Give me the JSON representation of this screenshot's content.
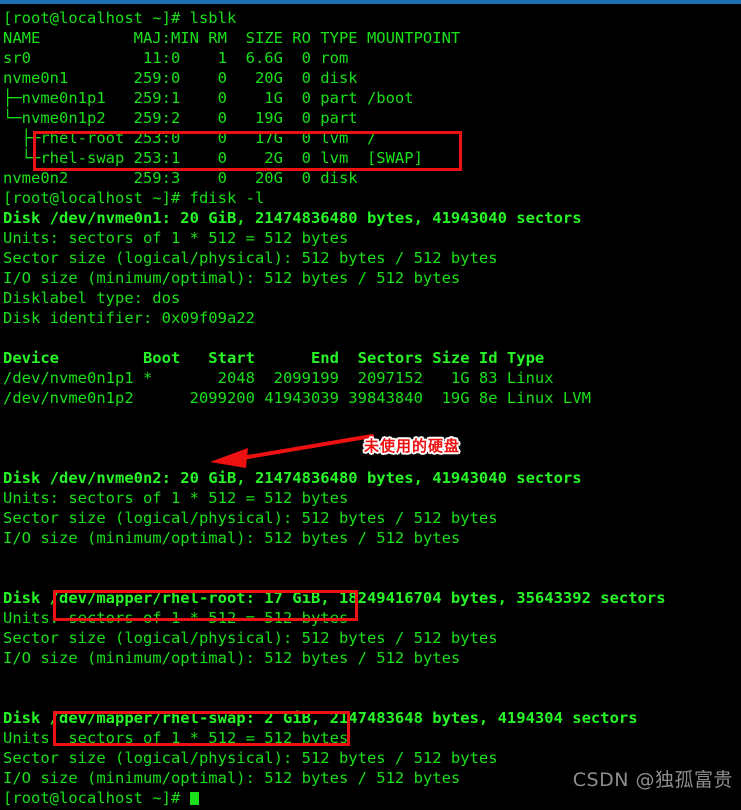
{
  "terminal": {
    "prompt": "[root@localhost ~]#",
    "lines": [
      {
        "text": "[root@localhost ~]# lsblk",
        "bold": false
      },
      {
        "text": "NAME          MAJ:MIN RM  SIZE RO TYPE MOUNTPOINT",
        "bold": false
      },
      {
        "text": "sr0            11:0    1  6.6G  0 rom",
        "bold": false
      },
      {
        "text": "nvme0n1       259:0    0   20G  0 disk",
        "bold": false
      },
      {
        "text": "├─nvme0n1p1   259:1    0    1G  0 part /boot",
        "bold": false
      },
      {
        "text": "└─nvme0n1p2   259:2    0   19G  0 part",
        "bold": false
      },
      {
        "text": "  ├─rhel-root 253:0    0   17G  0 lvm  /",
        "bold": false
      },
      {
        "text": "  └─rhel-swap 253:1    0    2G  0 lvm  [SWAP]",
        "bold": false
      },
      {
        "text": "nvme0n2       259:3    0   20G  0 disk",
        "bold": false
      },
      {
        "text": "[root@localhost ~]# fdisk -l",
        "bold": false
      },
      {
        "text": "Disk /dev/nvme0n1: 20 GiB, 21474836480 bytes, 41943040 sectors",
        "bold": true
      },
      {
        "text": "Units: sectors of 1 * 512 = 512 bytes",
        "bold": false
      },
      {
        "text": "Sector size (logical/physical): 512 bytes / 512 bytes",
        "bold": false
      },
      {
        "text": "I/O size (minimum/optimal): 512 bytes / 512 bytes",
        "bold": false
      },
      {
        "text": "Disklabel type: dos",
        "bold": false
      },
      {
        "text": "Disk identifier: 0x09f09a22",
        "bold": false
      },
      {
        "text": "",
        "bold": false
      },
      {
        "text": "Device         Boot   Start      End  Sectors Size Id Type",
        "bold": true
      },
      {
        "text": "/dev/nvme0n1p1 *       2048  2099199  2097152   1G 83 Linux",
        "bold": false
      },
      {
        "text": "/dev/nvme0n1p2      2099200 41943039 39843840  19G 8e Linux LVM",
        "bold": false
      },
      {
        "text": "",
        "bold": false
      },
      {
        "text": "",
        "bold": false
      },
      {
        "text": "",
        "bold": false
      },
      {
        "text": "Disk /dev/nvme0n2: 20 GiB, 21474836480 bytes, 41943040 sectors",
        "bold": true
      },
      {
        "text": "Units: sectors of 1 * 512 = 512 bytes",
        "bold": false
      },
      {
        "text": "Sector size (logical/physical): 512 bytes / 512 bytes",
        "bold": false
      },
      {
        "text": "I/O size (minimum/optimal): 512 bytes / 512 bytes",
        "bold": false
      },
      {
        "text": "",
        "bold": false
      },
      {
        "text": "",
        "bold": false
      },
      {
        "text": "Disk /dev/mapper/rhel-root: 17 GiB, 18249416704 bytes, 35643392 sectors",
        "bold": true
      },
      {
        "text": "Units: sectors of 1 * 512 = 512 bytes",
        "bold": false
      },
      {
        "text": "Sector size (logical/physical): 512 bytes / 512 bytes",
        "bold": false
      },
      {
        "text": "I/O size (minimum/optimal): 512 bytes / 512 bytes",
        "bold": false
      },
      {
        "text": "",
        "bold": false
      },
      {
        "text": "",
        "bold": false
      },
      {
        "text": "Disk /dev/mapper/rhel-swap: 2 GiB, 2147483648 bytes, 4194304 sectors",
        "bold": true
      },
      {
        "text": "Units: sectors of 1 * 512 = 512 bytes",
        "bold": false
      },
      {
        "text": "Sector size (logical/physical): 512 bytes / 512 bytes",
        "bold": false
      },
      {
        "text": "I/O size (minimum/optimal): 512 bytes / 512 bytes",
        "bold": false
      }
    ]
  },
  "lsblk_table": {
    "headers": [
      "NAME",
      "MAJ:MIN",
      "RM",
      "SIZE",
      "RO",
      "TYPE",
      "MOUNTPOINT"
    ],
    "rows": [
      [
        "sr0",
        "11:0",
        "1",
        "6.6G",
        "0",
        "rom",
        ""
      ],
      [
        "nvme0n1",
        "259:0",
        "0",
        "20G",
        "0",
        "disk",
        ""
      ],
      [
        "├─nvme0n1p1",
        "259:1",
        "0",
        "1G",
        "0",
        "part",
        "/boot"
      ],
      [
        "└─nvme0n1p2",
        "259:2",
        "0",
        "19G",
        "0",
        "part",
        ""
      ],
      [
        "  ├─rhel-root",
        "253:0",
        "0",
        "17G",
        "0",
        "lvm",
        "/"
      ],
      [
        "  └─rhel-swap",
        "253:1",
        "0",
        "2G",
        "0",
        "lvm",
        "[SWAP]"
      ],
      [
        "nvme0n2",
        "259:3",
        "0",
        "20G",
        "0",
        "disk",
        ""
      ]
    ]
  },
  "fdisk_partition_table": {
    "headers": [
      "Device",
      "Boot",
      "Start",
      "End",
      "Sectors",
      "Size",
      "Id",
      "Type"
    ],
    "rows": [
      [
        "/dev/nvme0n1p1",
        "*",
        "2048",
        "2099199",
        "2097152",
        "1G",
        "83",
        "Linux"
      ],
      [
        "/dev/nvme0n1p2",
        "",
        "2099200",
        "41943039",
        "39843840",
        "19G",
        "8e",
        "Linux LVM"
      ]
    ]
  },
  "annotations": {
    "unused_disk_label": "未使用的硬盘",
    "highlight_color": "#ee1111",
    "boxes": [
      {
        "name": "lvm-volumes-box",
        "target": "rhel-root and rhel-swap lsblk rows"
      },
      {
        "name": "rhel-root-box",
        "target": "/dev/mapper/rhel-root: 17 GiB,"
      },
      {
        "name": "rhel-swap-box",
        "target": "/dev/mapper/rhel-swap: 2 GiB,"
      }
    ]
  },
  "watermark": {
    "text": "CSDN @独孤富贵",
    "color": "#8d8d8d"
  }
}
